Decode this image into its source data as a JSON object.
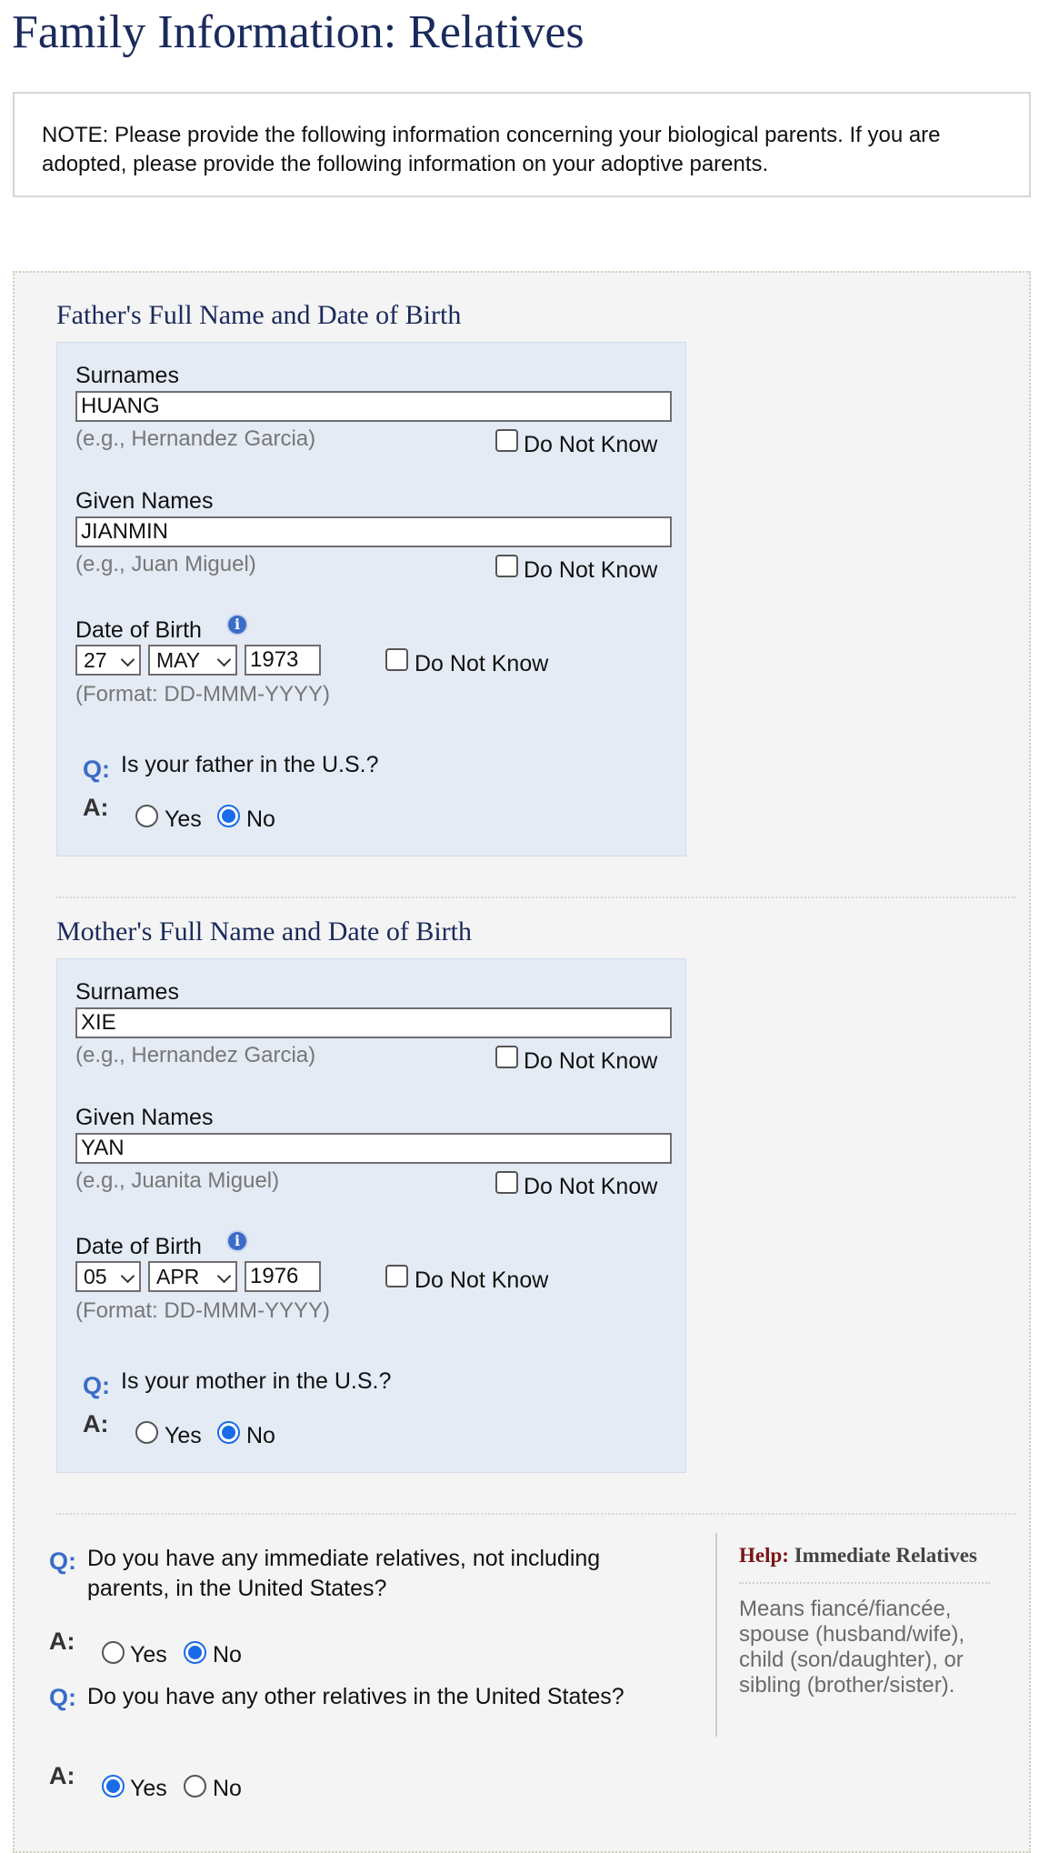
{
  "page": {
    "title": "Family Information: Relatives"
  },
  "note": "NOTE: Please provide the following information concerning your biological parents. If you are adopted, please provide the following information on your adoptive parents.",
  "father": {
    "section_title": "Father's Full Name and Date of Birth",
    "surnames_label": "Surnames",
    "surnames_value": "HUANG",
    "surnames_hint": "(e.g., Hernandez Garcia)",
    "given_label": "Given Names",
    "given_value": "JIANMIN",
    "given_hint": "(e.g., Juan Miguel)",
    "dob_label": "Date of Birth",
    "dob_day": "27",
    "dob_month": "MAY",
    "dob_year": "1973",
    "dob_format": "(Format: DD-MMM-YYYY)",
    "question": "Is your father in the U.S.?",
    "answer": "No"
  },
  "mother": {
    "section_title": "Mother's Full Name and Date of Birth",
    "surnames_label": "Surnames",
    "surnames_value": "XIE",
    "surnames_hint": "(e.g., Hernandez Garcia)",
    "given_label": "Given Names",
    "given_value": "YAN",
    "given_hint": "(e.g., Juanita Miguel)",
    "dob_label": "Date of Birth",
    "dob_day": "05",
    "dob_month": "APR",
    "dob_year": "1976",
    "dob_format": "(Format: DD-MMM-YYYY)",
    "question": "Is your mother in the U.S.?",
    "answer": "No"
  },
  "common": {
    "do_not_know": "Do Not Know",
    "q_marker": "Q:",
    "a_marker": "A:",
    "yes": "Yes",
    "no": "No",
    "info_icon": "info-icon"
  },
  "relatives": {
    "immediate_question": "Do you have any immediate relatives, not including parents, in the United States?",
    "immediate_answer": "No",
    "other_question": "Do you have any other relatives in the United States?",
    "other_answer": "Yes"
  },
  "help": {
    "label": "Help:",
    "title": "Immediate Relatives",
    "body": "Means fiancé/fiancée, spouse (husband/wife), child (son/daughter), or sibling (brother/sister)."
  },
  "colors": {
    "heading": "#1a2a5c",
    "panel_bg": "#e4ebf5",
    "accent_blue": "#3a6cc8",
    "radio_selected": "#1a6be8",
    "help_label": "#7a1515"
  }
}
